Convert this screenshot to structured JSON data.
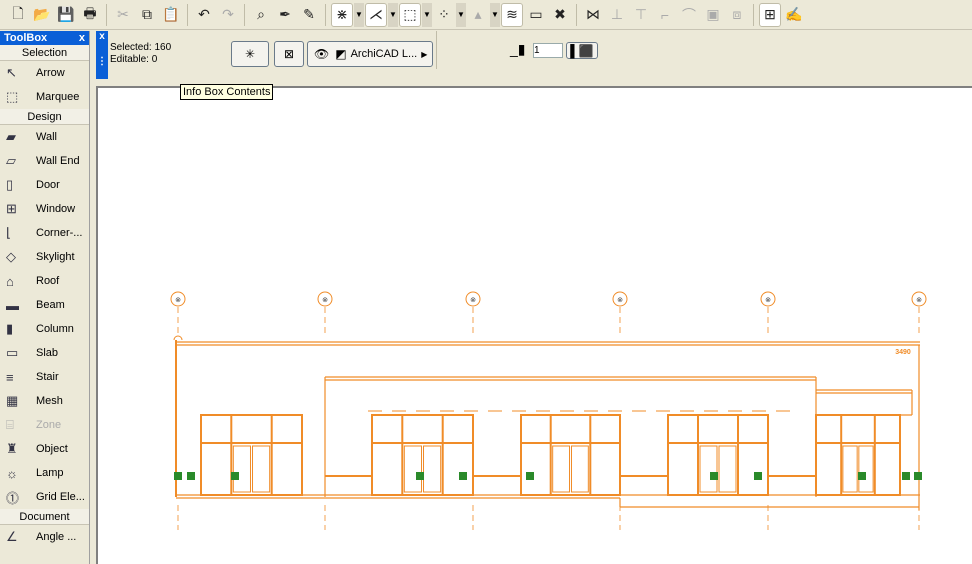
{
  "toolbar": {
    "icons": [
      "new-file",
      "open-folder",
      "save",
      "print",
      "cut",
      "copy",
      "paste",
      "undo",
      "redo",
      "zoom-find",
      "eyedropper",
      "syringe",
      "magic-wand",
      "angle",
      "selection-text",
      "gravity",
      "mark",
      "layer-settings",
      "ruler",
      "close-x",
      "split",
      "adjust",
      "trim",
      "fillet",
      "curve",
      "drag",
      "resize",
      "floor-plan",
      "pen"
    ]
  },
  "toolbox": {
    "title": "ToolBox",
    "close": "x",
    "groups": [
      {
        "label": "Selection",
        "items": [
          {
            "label": "Arrow",
            "icon": "arrow"
          },
          {
            "label": "Marquee",
            "icon": "marquee"
          }
        ]
      },
      {
        "label": "Design",
        "items": [
          {
            "label": "Wall",
            "icon": "wall"
          },
          {
            "label": "Wall End",
            "icon": "wall-end"
          },
          {
            "label": "Door",
            "icon": "door"
          },
          {
            "label": "Window",
            "icon": "window"
          },
          {
            "label": "Corner-...",
            "icon": "corner-window"
          },
          {
            "label": "Skylight",
            "icon": "skylight"
          },
          {
            "label": "Roof",
            "icon": "roof"
          },
          {
            "label": "Beam",
            "icon": "beam"
          },
          {
            "label": "Column",
            "icon": "column"
          },
          {
            "label": "Slab",
            "icon": "slab"
          },
          {
            "label": "Stair",
            "icon": "stair"
          },
          {
            "label": "Mesh",
            "icon": "mesh"
          },
          {
            "label": "Zone",
            "icon": "zone",
            "disabled": true
          },
          {
            "label": "Object",
            "icon": "object"
          },
          {
            "label": "Lamp",
            "icon": "lamp"
          },
          {
            "label": "Grid Ele...",
            "icon": "grid-element"
          }
        ]
      },
      {
        "label": "Document",
        "items": [
          {
            "label": "Angle ...",
            "icon": "angle-dimension"
          }
        ]
      }
    ]
  },
  "infobox": {
    "close": "x",
    "selected": "Selected: 160",
    "editable": "Editable: 0",
    "layer_label": "ArchiCAD L...",
    "pen_value": "1"
  },
  "tooltip": "Info Box Contents",
  "drawing": {
    "dimension_label": "3490",
    "line_color": "#f08c28"
  }
}
